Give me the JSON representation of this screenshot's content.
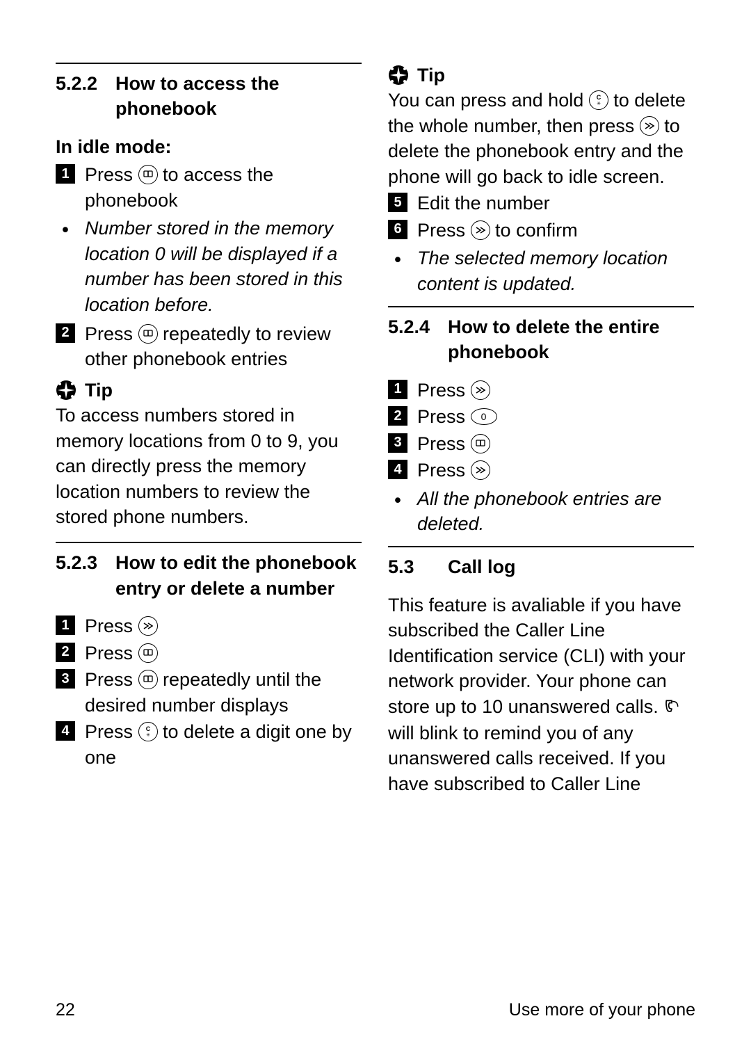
{
  "left": {
    "h522": {
      "num": "5.2.2",
      "title": "How to access the phonebook"
    },
    "idle_heading": "In idle mode:",
    "s1a": "Press ",
    "s1b": " to access the phonebook",
    "note1": "Number stored in the memory location 0 will be displayed if a number has been stored in this location before.",
    "s2a": "Press ",
    "s2b": " repeatedly to review other phonebook entries",
    "tip_label": "Tip",
    "tip1": "To access numbers stored in memory locations from 0 to 9, you can directly press the memory location numbers to review the stored phone numbers.",
    "h523": {
      "num": "5.2.3",
      "title": "How to edit the phonebook entry or delete a number"
    },
    "e1": "Press ",
    "e2": "Press ",
    "e3a": "Press ",
    "e3b": " repeatedly until the desired number displays",
    "e4a": "Press ",
    "e4b": " to delete a digit one by one"
  },
  "right": {
    "tip_label": "Tip",
    "tip2a": "You can press and hold ",
    "tip2b": " to delete the whole number, then press ",
    "tip2c": " to delete the phonebook entry and the phone will go back to idle screen.",
    "s5": "Edit the number",
    "s6a": "Press ",
    "s6b": " to confirm",
    "note2": "The selected memory location content is updated.",
    "h524": {
      "num": "5.2.4",
      "title": "How to delete the entire phonebook"
    },
    "d1": "Press ",
    "d2": "Press ",
    "d3": "Press ",
    "d4": "Press ",
    "note3": "All the phonebook entries are deleted.",
    "h53": {
      "num": "5.3",
      "title": "Call log"
    },
    "calllog_a": "This feature is avaliable if you have subscribed the Caller Line Identification service (CLI) with your network provider. Your phone can store up to 10 unanswered calls. ",
    "calllog_b": " will blink to remind you of any unanswered calls received. If you have subscribed to Caller Line"
  },
  "footer": {
    "page_num": "22",
    "section": "Use more of your phone"
  },
  "icons": {
    "book": "book-icon",
    "prog": "program-icon",
    "clear": "clear-icon",
    "zero": "0",
    "phone": "handset-icon",
    "tip": "tip-sparkle-icon"
  }
}
